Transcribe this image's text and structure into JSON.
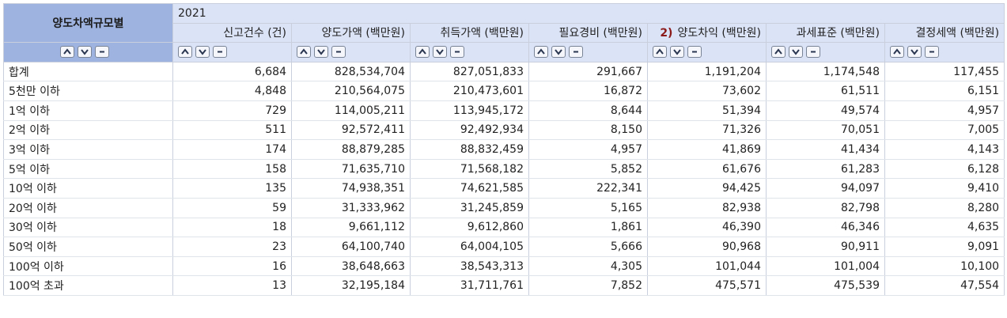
{
  "header": {
    "row_header_label": "양도차액규모별",
    "year": "2021",
    "columns": [
      {
        "label": "신고건수 (건)"
      },
      {
        "label": "양도가액 (백만원)"
      },
      {
        "label": "취득가액 (백만원)"
      },
      {
        "label": "필요경비 (백만원)"
      },
      {
        "note": "2)",
        "label": "양도차익 (백만원)"
      },
      {
        "label": "과세표준 (백만원)"
      },
      {
        "label": "결정세액 (백만원)"
      }
    ]
  },
  "sort_buttons": {
    "up": "sort-up-icon",
    "down": "sort-down-icon",
    "remove": "remove-icon"
  },
  "rows": [
    {
      "label": "합계",
      "values": [
        "6,684",
        "828,534,704",
        "827,051,833",
        "291,667",
        "1,191,204",
        "1,174,548",
        "117,455"
      ]
    },
    {
      "label": "5천만 이하",
      "values": [
        "4,848",
        "210,564,075",
        "210,473,601",
        "16,872",
        "73,602",
        "61,511",
        "6,151"
      ]
    },
    {
      "label": "1억 이하",
      "values": [
        "729",
        "114,005,211",
        "113,945,172",
        "8,644",
        "51,394",
        "49,574",
        "4,957"
      ]
    },
    {
      "label": "2억 이하",
      "values": [
        "511",
        "92,572,411",
        "92,492,934",
        "8,150",
        "71,326",
        "70,051",
        "7,005"
      ]
    },
    {
      "label": "3억 이하",
      "values": [
        "174",
        "88,879,285",
        "88,832,459",
        "4,957",
        "41,869",
        "41,434",
        "4,143"
      ]
    },
    {
      "label": "5억 이하",
      "values": [
        "158",
        "71,635,710",
        "71,568,182",
        "5,852",
        "61,676",
        "61,283",
        "6,128"
      ]
    },
    {
      "label": "10억 이하",
      "values": [
        "135",
        "74,938,351",
        "74,621,585",
        "222,341",
        "94,425",
        "94,097",
        "9,410"
      ]
    },
    {
      "label": "20억 이하",
      "values": [
        "59",
        "31,333,962",
        "31,245,859",
        "5,165",
        "82,938",
        "82,798",
        "8,280"
      ]
    },
    {
      "label": "30억 이하",
      "values": [
        "18",
        "9,661,112",
        "9,612,860",
        "1,861",
        "46,390",
        "46,346",
        "4,635"
      ]
    },
    {
      "label": "50억 이하",
      "values": [
        "23",
        "64,100,740",
        "64,004,105",
        "5,666",
        "90,968",
        "90,911",
        "9,091"
      ]
    },
    {
      "label": "100억 이하",
      "values": [
        "16",
        "38,648,663",
        "38,543,313",
        "4,305",
        "101,044",
        "101,004",
        "10,100"
      ]
    },
    {
      "label": "100억 초과",
      "values": [
        "13",
        "32,195,184",
        "31,711,761",
        "7,852",
        "475,571",
        "475,539",
        "47,554"
      ]
    }
  ]
}
